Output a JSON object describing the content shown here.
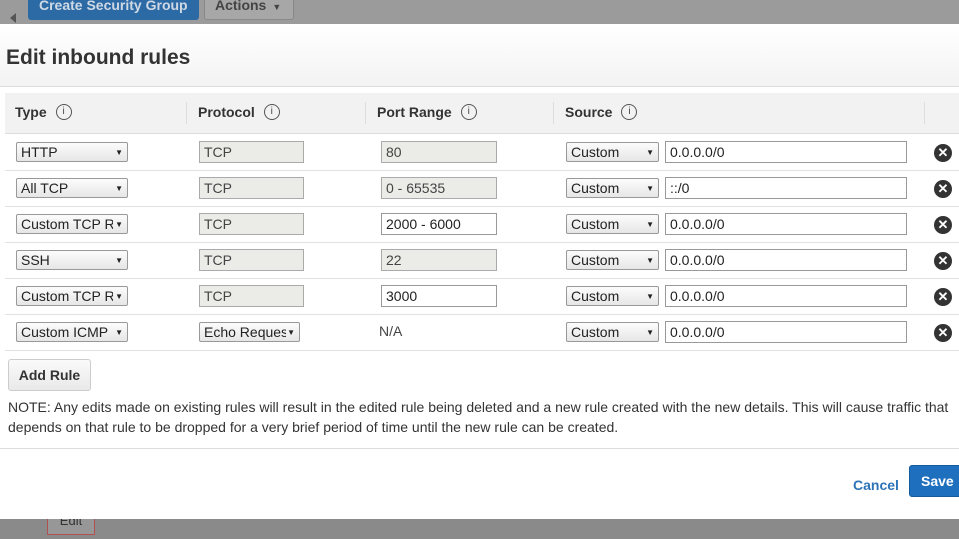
{
  "background": {
    "create_sg_label": "Create Security Group",
    "actions_label": "Actions",
    "edit_label": "Edit"
  },
  "modal": {
    "title": "Edit inbound rules",
    "columns": {
      "type": "Type",
      "protocol": "Protocol",
      "port_range": "Port Range",
      "source": "Source",
      "info_icon": "i"
    },
    "rules": [
      {
        "type": "HTTP",
        "protocol": "TCP",
        "port_range": "80",
        "source_type": "Custom",
        "source": "0.0.0.0/0"
      },
      {
        "type": "All TCP",
        "protocol": "TCP",
        "port_range": "0 - 65535",
        "source_type": "Custom",
        "source": "::/0"
      },
      {
        "type": "Custom TCP R",
        "protocol": "TCP",
        "port_range": "2000 - 6000",
        "source_type": "Custom",
        "source": "0.0.0.0/0"
      },
      {
        "type": "SSH",
        "protocol": "TCP",
        "port_range": "22",
        "source_type": "Custom",
        "source": "0.0.0.0/0"
      },
      {
        "type": "Custom TCP R",
        "protocol": "TCP",
        "port_range": "3000",
        "source_type": "Custom",
        "source": "0.0.0.0/0"
      },
      {
        "type": "Custom ICMP",
        "protocol": "Echo Reques",
        "port_range": "N/A",
        "source_type": "Custom",
        "source": "0.0.0.0/0"
      }
    ],
    "add_rule_label": "Add Rule",
    "note": "NOTE: Any edits made on existing rules will result in the edited rule being deleted and a new rule created with the new details. This will cause traffic that depends on that rule to be dropped for a very brief period of time until the new rule can be created.",
    "cancel_label": "Cancel",
    "save_label": "Save"
  }
}
